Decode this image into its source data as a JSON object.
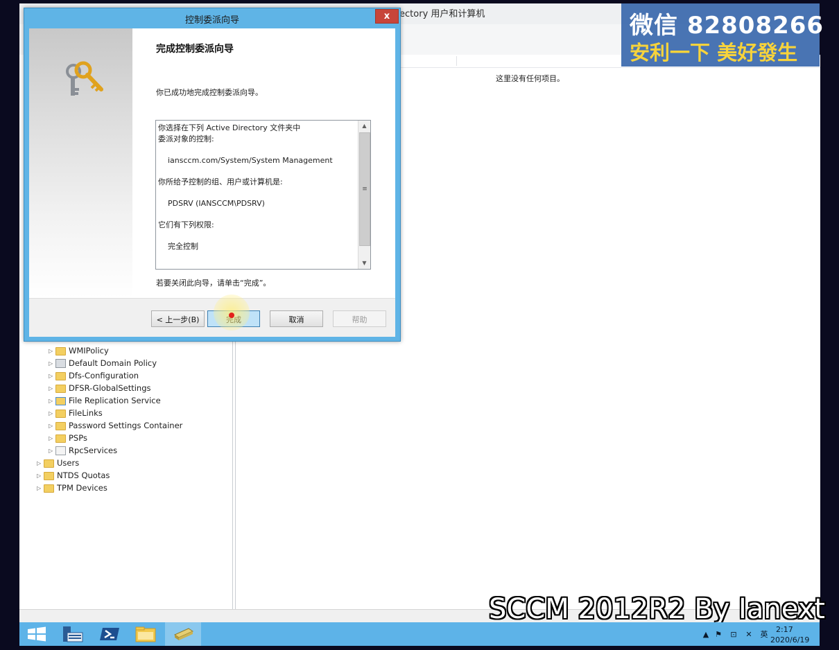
{
  "window": {
    "title": "Active Directory 用户和计算机",
    "right_pane_empty_text": "这里没有任何项目。"
  },
  "tree": {
    "items": [
      {
        "label": "WMIPolicy",
        "icon": "folder-icon"
      },
      {
        "label": "Default Domain Policy",
        "icon": "policy-object-icon"
      },
      {
        "label": "Dfs-Configuration",
        "icon": "folder-icon"
      },
      {
        "label": "DFSR-GlobalSettings",
        "icon": "folder-icon"
      },
      {
        "label": "File Replication Service",
        "icon": "replication-folder-icon"
      },
      {
        "label": "FileLinks",
        "icon": "folder-icon"
      },
      {
        "label": "Password Settings Container",
        "icon": "folder-icon"
      },
      {
        "label": "PSPs",
        "icon": "folder-icon"
      },
      {
        "label": "RpcServices",
        "icon": "rpc-services-icon"
      },
      {
        "label": "Users",
        "icon": "folder-icon"
      },
      {
        "label": "NTDS Quotas",
        "icon": "folder-icon"
      },
      {
        "label": "TPM Devices",
        "icon": "folder-icon"
      }
    ]
  },
  "dialog": {
    "title": "控制委派向导",
    "close_label": "x",
    "heading": "完成控制委派向导",
    "success_text": "你已成功地完成控制委派向导。",
    "summary_text": "你选择在下列 Active Directory 文件夹中\n委派对象的控制:\n\n    iansccm.com/System/System Management\n\n你所给予控制的组、用户或计算机是:\n\n    PDSRV (IANSCCM\\PDSRV)\n\n它们有下列权限:\n\n    完全控制",
    "close_hint": "若要关闭此向导，请单击“完成”。",
    "buttons": {
      "back": "< 上一步(B)",
      "finish": "完成",
      "cancel": "取消",
      "help": "帮助"
    }
  },
  "watermark": {
    "line1": "微信 82808266",
    "line2": "安利一下 美好發生"
  },
  "caption": "SCCM 2012R2 By Ianext",
  "taskbar": {
    "time": "2:17",
    "date": "2020/6/19",
    "ime": "英"
  },
  "colors": {
    "taskbar": "#5db3e8",
    "dialog_frame": "#5fb4e6",
    "close_button": "#c7453a",
    "watermark_bg": "#3a68ad",
    "watermark_accent": "#f7d33b"
  }
}
